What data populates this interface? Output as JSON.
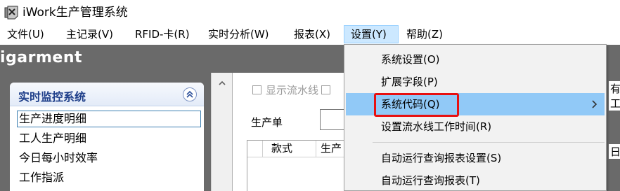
{
  "window": {
    "title": "iWork生产管理系统",
    "icon": "app-shield-icon"
  },
  "menubar": [
    {
      "label": "文件(U)"
    },
    {
      "label": "主记录(V)"
    },
    {
      "label": "RFID-卡(R)"
    },
    {
      "label": "实时分析(W)"
    },
    {
      "label": "报表(X)"
    },
    {
      "label": "设置(Y)",
      "active": true
    },
    {
      "label": "帮助(Z)"
    }
  ],
  "brand": {
    "text": "igarment"
  },
  "nav": {
    "title": "实时监控系统",
    "collapse_icon": "double-chevron-up-icon",
    "items": [
      {
        "label": "生产进度明细",
        "selected": true
      },
      {
        "label": "工人生产明细"
      },
      {
        "label": "今日每小时效率"
      },
      {
        "label": "工作指派"
      }
    ]
  },
  "content": {
    "show_line_label": "显示流水线",
    "order_label": "生产单",
    "grid_columns": [
      "",
      "款式",
      "生产"
    ],
    "right_edge_top": "有工",
    "right_edge_bottom": "日"
  },
  "settings_menu": {
    "items": [
      {
        "label": "系统设置(O)"
      },
      {
        "label": "扩展字段(P)"
      },
      {
        "label": "系统代码(Q)",
        "hover": true,
        "has_submenu": true
      },
      {
        "label": "设置流水线工作时间(R)"
      },
      {
        "separator": true
      },
      {
        "label": "自动运行查询报表设置(S)"
      },
      {
        "label": "自动运行查询报表(T)"
      }
    ],
    "highlight_color": "#e81010",
    "hover_color": "#91c9f7"
  }
}
